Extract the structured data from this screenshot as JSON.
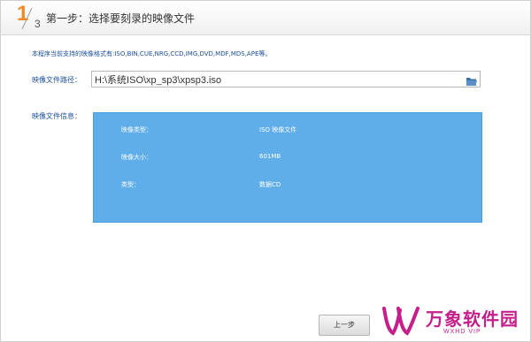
{
  "header": {
    "step_current": "1",
    "step_total": "3",
    "title": "第一步：选择要刻录的映像文件"
  },
  "supported_formats": "本程序当前支持的映像格式有:ISO,BIN,CUE,NRG,CCD,IMG,DVD,MDF,MDS,APE等。",
  "path": {
    "label": "映像文件路径：",
    "value": "H:\\系统ISO\\xp_sp3\\xpsp3.iso",
    "browse_icon": "folder-open-icon"
  },
  "info": {
    "label": "映像文件信息：",
    "rows": [
      {
        "key": "映像类型：",
        "value": "ISO 映像文件"
      },
      {
        "key": "映像大小：",
        "value": "601MB"
      },
      {
        "key": "类型：",
        "value": "数据CD"
      }
    ],
    "panel_color": "#5faee9"
  },
  "buttons": {
    "back": "上一步"
  },
  "watermark": {
    "name": "万象软件园",
    "sub": "WXHD VIP"
  }
}
